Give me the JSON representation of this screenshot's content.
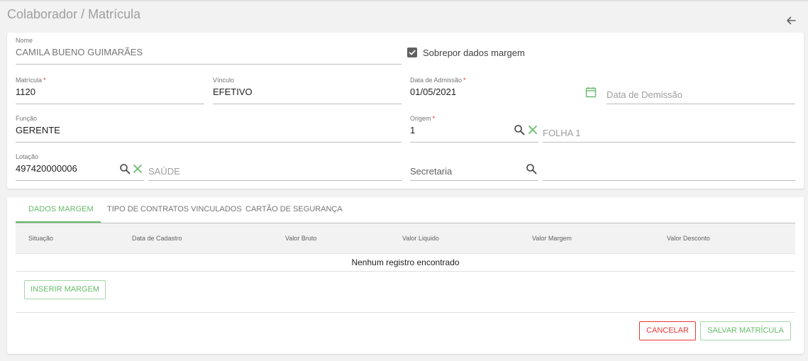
{
  "header": {
    "title": "Colaborador / Matrícula",
    "back_icon": "arrow-left-icon"
  },
  "form": {
    "nome": {
      "label": "Nome",
      "value": "CAMILA BUENO GUIMARÃES"
    },
    "sobrepor": {
      "label": "Sobrepor dados margem",
      "checked": true
    },
    "matricula": {
      "label": "Matrícula",
      "required": "*",
      "value": "1120"
    },
    "vinculo": {
      "label": "Vínculo",
      "value": "EFETIVO"
    },
    "data_admissao": {
      "label": "Data de Admissão",
      "required": "*",
      "value": "01/05/2021"
    },
    "data_demissao": {
      "placeholder": "Data de Demissão"
    },
    "funcao": {
      "label": "Função",
      "value": "GERENTE"
    },
    "origem": {
      "label": "Origem",
      "required": "*",
      "value": "1",
      "description": "FOLHA 1"
    },
    "lotacao": {
      "label": "Lotação",
      "value": "497420000006",
      "description": "SAÚDE"
    },
    "secretaria": {
      "placeholder": "Secretaria",
      "description": ""
    }
  },
  "tabs": [
    {
      "label": "DADOS MARGEM",
      "active": true
    },
    {
      "label": "TIPO DE CONTRATOS VINCULADOS",
      "active": false
    },
    {
      "label": "CARTÃO DE SEGURANÇA",
      "active": false
    }
  ],
  "table": {
    "columns": [
      "Situação",
      "Data de Cadastro",
      "Valor Bruto",
      "Valor Liquido",
      "Valor Margem",
      "Valor Desconto"
    ],
    "empty_message": "Nenhum registro encontrado"
  },
  "actions": {
    "insert_label": "INSERIR MARGEM",
    "cancel_label": "CANCELAR",
    "save_label": "SALVAR MATRÍCULA"
  },
  "colors": {
    "accent": "#66bb6a",
    "danger": "#e53935",
    "text_muted": "#757575"
  }
}
